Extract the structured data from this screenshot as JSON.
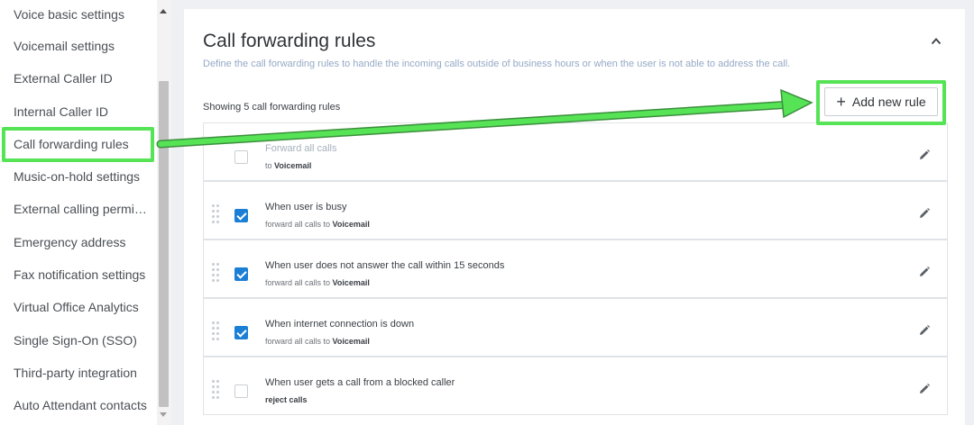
{
  "sidebar": {
    "items": [
      {
        "label": "Voice basic settings"
      },
      {
        "label": "Voicemail settings"
      },
      {
        "label": "External Caller ID"
      },
      {
        "label": "Internal Caller ID"
      },
      {
        "label": "Call forwarding rules"
      },
      {
        "label": "Music-on-hold settings"
      },
      {
        "label": "External calling permissions"
      },
      {
        "label": "Emergency address"
      },
      {
        "label": "Fax notification settings"
      },
      {
        "label": "Virtual Office Analytics"
      },
      {
        "label": "Single Sign-On (SSO)"
      },
      {
        "label": "Third-party integration"
      },
      {
        "label": "Auto Attendant contacts"
      }
    ]
  },
  "section": {
    "title": "Call forwarding rules",
    "subtitle": "Define the call forwarding rules to handle the incoming calls outside of business hours or when the user is not able to address the call.",
    "showing": "Showing 5 call forwarding rules",
    "add_button": "Add new rule",
    "add_icon": "+"
  },
  "rules": [
    {
      "title": "Forward all calls",
      "sub_prefix": "to ",
      "sub_bold": "Voicemail",
      "checked": false,
      "muted": true
    },
    {
      "title": "When user is busy",
      "sub_prefix": "forward all calls to ",
      "sub_bold": "Voicemail",
      "checked": true,
      "muted": false
    },
    {
      "title": "When user does not answer the call within 15 seconds",
      "sub_prefix": "forward all calls to ",
      "sub_bold": "Voicemail",
      "checked": true,
      "muted": false
    },
    {
      "title": "When internet connection is down",
      "sub_prefix": "forward all calls to ",
      "sub_bold": "Voicemail",
      "checked": true,
      "muted": false
    },
    {
      "title": "When user gets a call from a blocked caller",
      "sub_prefix": "",
      "sub_bold": "reject calls",
      "checked": false,
      "muted": false
    }
  ],
  "colors": {
    "accent": "#1b7fd6",
    "highlight": "#56e356",
    "subtitle": "#95a9c6"
  }
}
